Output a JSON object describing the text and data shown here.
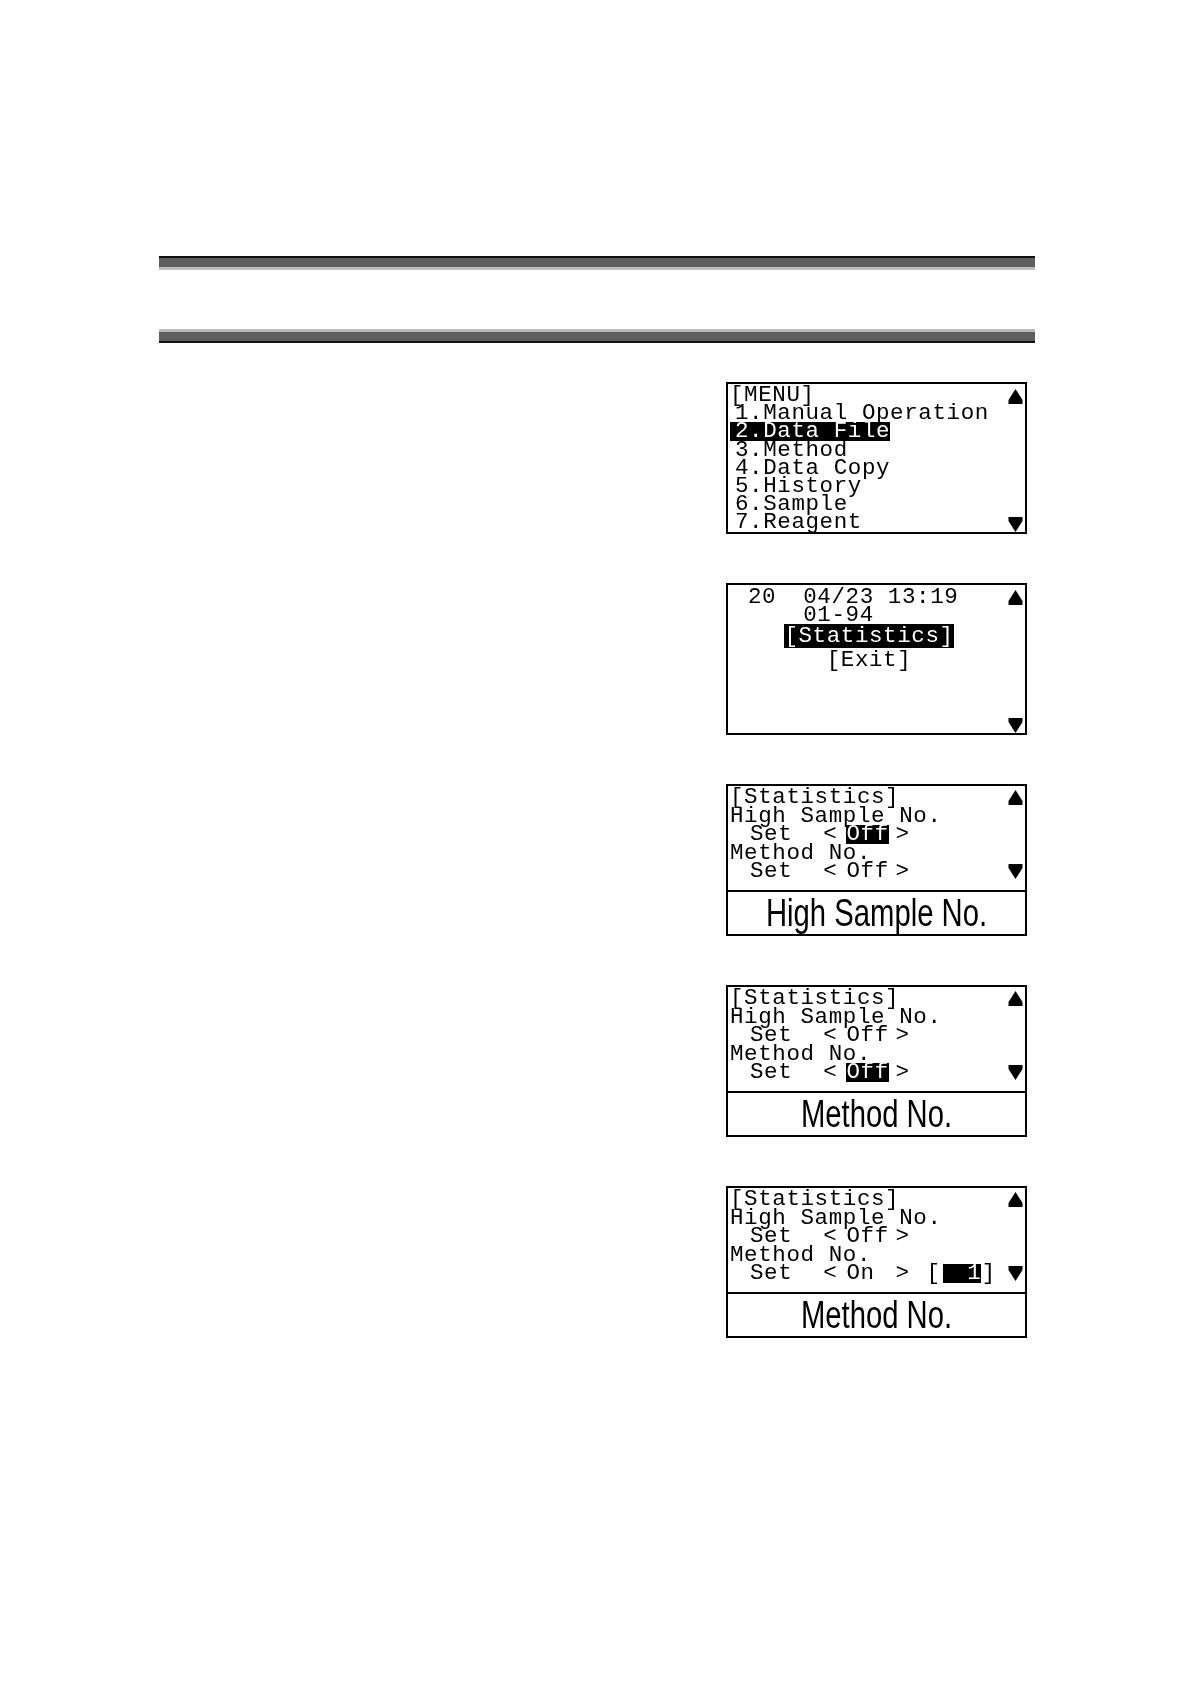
{
  "screens": [
    {
      "kind": "menu",
      "title": "[MENU]",
      "items": [
        {
          "label": "1.Manual Operation",
          "selected": false
        },
        {
          "label": "2.Data File",
          "selected": true
        },
        {
          "label": "3.Method",
          "selected": false
        },
        {
          "label": "4.Data Copy",
          "selected": false
        },
        {
          "label": "5.History",
          "selected": false
        },
        {
          "label": "6.Sample",
          "selected": false
        },
        {
          "label": "7.Reagent",
          "selected": false
        }
      ]
    },
    {
      "kind": "file",
      "number": "20",
      "datetime": "04/23 13:19",
      "range": "01-94",
      "options": [
        {
          "label": "[Statistics]",
          "selected": true
        },
        {
          "label": "[Exit]",
          "selected": false
        }
      ]
    },
    {
      "kind": "settings",
      "title": "[Statistics]",
      "settings": [
        {
          "label": "High Sample No.",
          "set_label": "Set",
          "open": "<",
          "value": "Off",
          "close": ">",
          "selected": true
        },
        {
          "label": "Method No.",
          "set_label": "Set",
          "open": "<",
          "value": "Off",
          "close": ">",
          "selected": false
        }
      ],
      "help": "High Sample No."
    },
    {
      "kind": "settings",
      "title": "[Statistics]",
      "settings": [
        {
          "label": "High Sample No.",
          "set_label": "Set",
          "open": "<",
          "value": "Off",
          "close": ">",
          "selected": false
        },
        {
          "label": "Method No.",
          "set_label": "Set",
          "open": "<",
          "value": "Off",
          "close": ">",
          "selected": true
        }
      ],
      "help": "Method No."
    },
    {
      "kind": "settings",
      "title": "[Statistics]",
      "settings": [
        {
          "label": "High Sample No.",
          "set_label": "Set",
          "open": "<",
          "value": "Off",
          "close": ">",
          "selected": false
        },
        {
          "label": "Method No.",
          "set_label": "Set",
          "open": "<",
          "value": "On",
          "close": ">",
          "selected": false,
          "number": {
            "open": "[",
            "value": "1",
            "close": "]",
            "selected": true
          }
        }
      ],
      "help": "Method No."
    }
  ]
}
